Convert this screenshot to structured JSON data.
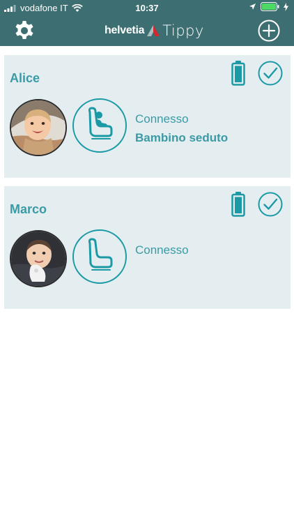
{
  "status_bar": {
    "carrier": "vodafone IT",
    "time": "10:37",
    "icons": [
      "signal-icon",
      "wifi-icon",
      "location-icon",
      "battery-icon",
      "charging-icon"
    ]
  },
  "nav": {
    "brand": "helvetia",
    "app_name": "Tippy",
    "left_icon": "gear-icon",
    "right_icon": "plus-circle-icon"
  },
  "children": [
    {
      "name": "Alice",
      "status_connection": "Connesso",
      "status_seat": "Bambino seduto",
      "seat_occupied": true,
      "battery_icon": "battery-icon",
      "check_icon": "check-circle-icon"
    },
    {
      "name": "Marco",
      "status_connection": "Connesso",
      "status_seat": "",
      "seat_occupied": false,
      "battery_icon": "battery-icon",
      "check_icon": "check-circle-icon"
    }
  ],
  "colors": {
    "header": "#3d6f72",
    "accent": "#1b9aa6",
    "card_bg": "#e4eef0",
    "brand_red": "#d8262d"
  }
}
